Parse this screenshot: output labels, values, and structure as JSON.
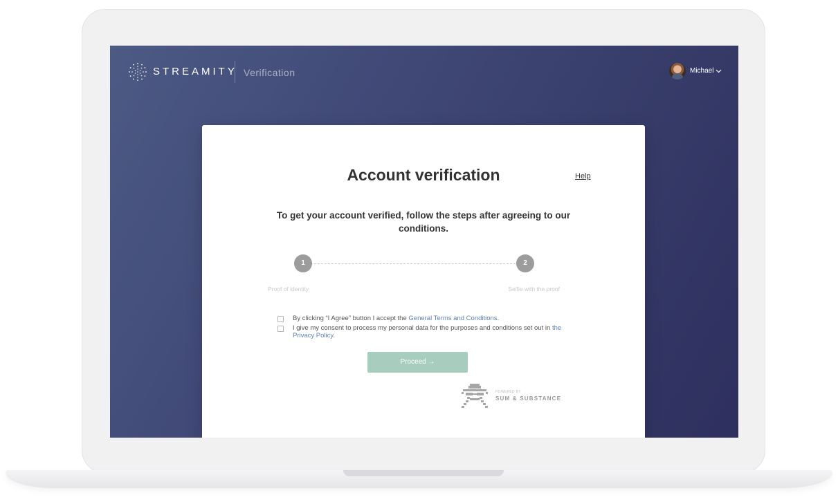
{
  "header": {
    "brand": "STREAMITY",
    "section": "Verification",
    "user_name": "Michael",
    "icons": {
      "logo": "spiral-dots-logo-icon",
      "avatar": "user-avatar",
      "chevron": "chevron-down-icon"
    }
  },
  "card": {
    "title": "Account verification",
    "help": "Help",
    "subtitle": "To get your account verified, follow the steps after agreeing to our conditions.",
    "steps": [
      {
        "number": "1",
        "label": "Proof of identity"
      },
      {
        "number": "2",
        "label": "Selfie with the proof"
      }
    ],
    "consents": [
      {
        "text": "By clicking “I Agree” button I accept the ",
        "link": "General Terms and Conditions",
        "suffix": ".",
        "checked": false
      },
      {
        "text": "I give my consent to process my personal data for the purposes and conditions set out in ",
        "link": "the Privacy Policy",
        "suffix": ".",
        "checked": false
      }
    ],
    "proceed_label": "Proceed →",
    "powered_by_small": "POWERED BY",
    "powered_by_brand": "SUM & SUBSTANCE"
  },
  "colors": {
    "screen_bg_start": "#4c5a84",
    "screen_bg_end": "#2e2f5e",
    "proceed_button": "#a7cdbf",
    "link": "#5b7fb0",
    "step_circle": "#9c9c9c"
  }
}
